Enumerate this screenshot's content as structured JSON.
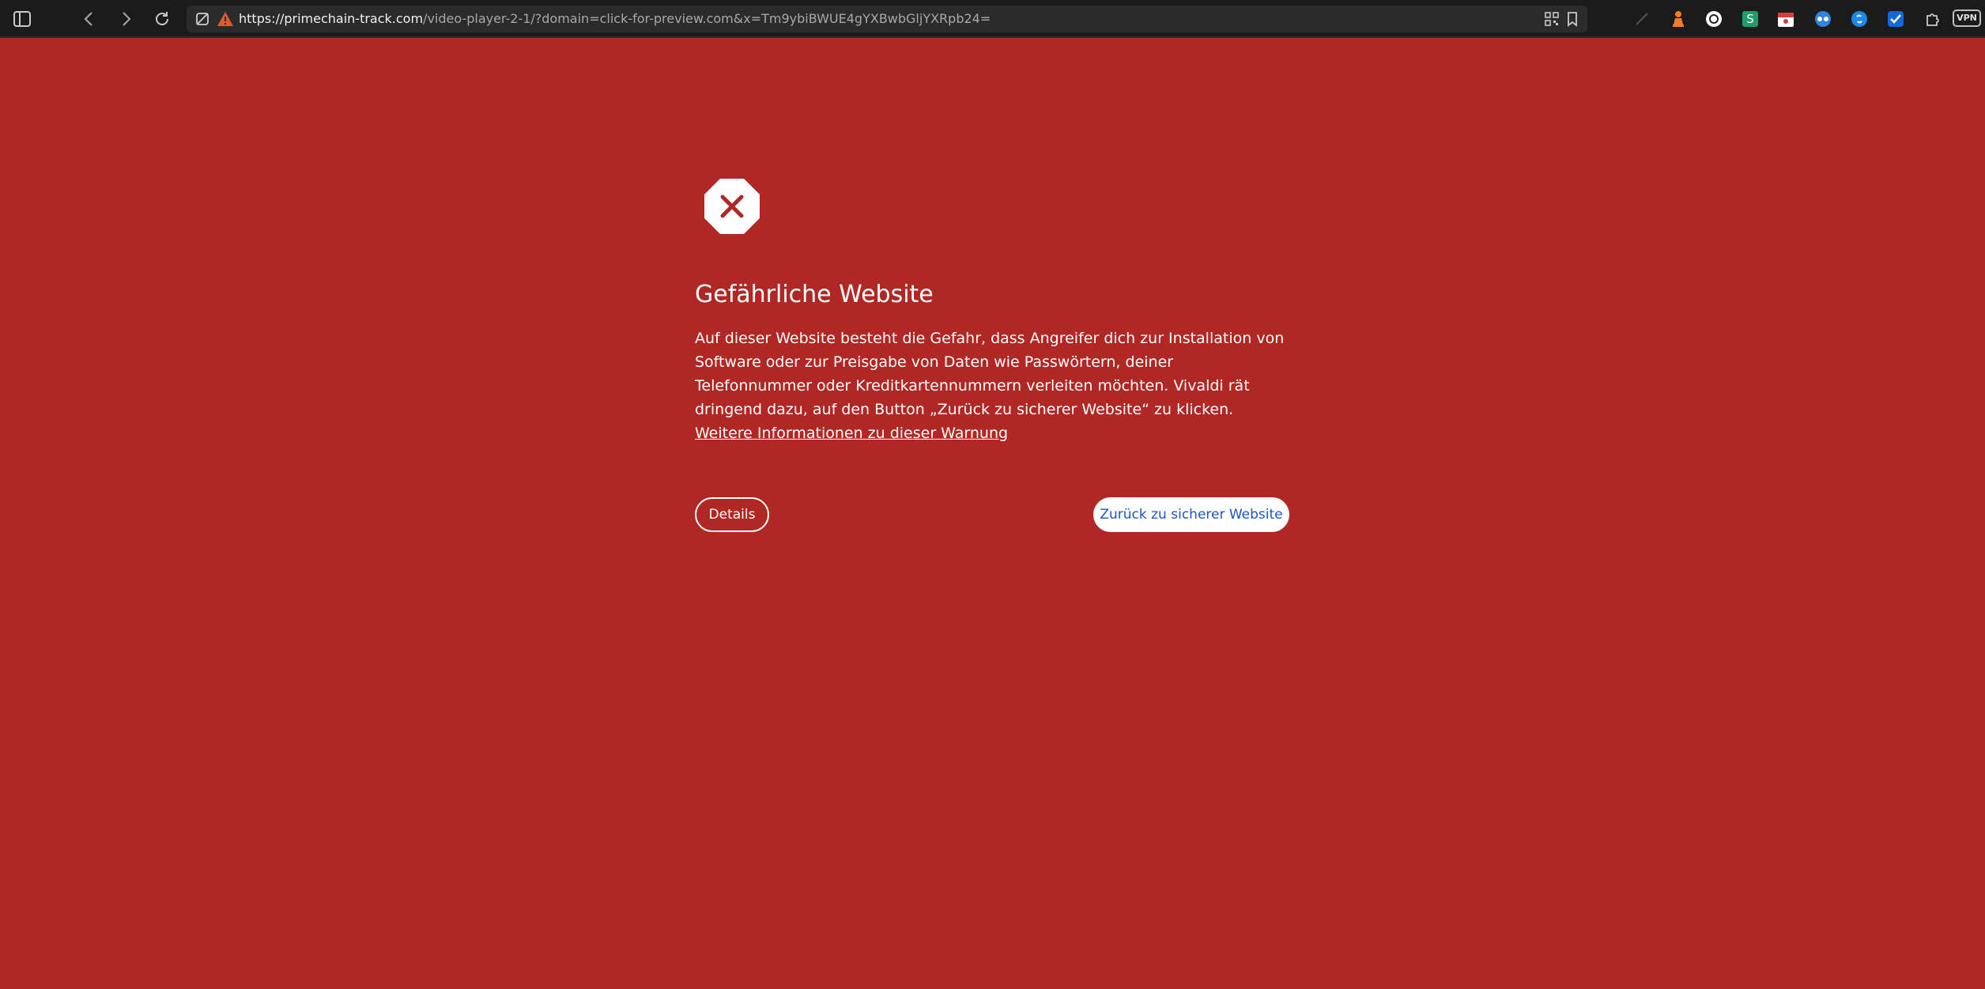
{
  "browser": {
    "url_host": "https://primechain-track.com",
    "url_rest": "/video-player-2-1/?domain=click-for-preview.com&x=Tm9ybiBWUE4gYXBwbGljYXRpb24=",
    "vpn_label": "VPN",
    "toolbar_icons": [
      "panel-toggle-icon",
      "back-icon",
      "forward-icon",
      "reload-icon"
    ],
    "extension_icons": [
      "feather-icon",
      "chess-pawn-icon",
      "circle-extension-icon",
      "s-extension-icon",
      "calendar-icon",
      "glasses-icon",
      "shazam-icon",
      "checkmark-icon",
      "puzzle-icon"
    ]
  },
  "warning": {
    "icon": "stop-x-icon",
    "title": "Gefährliche Website",
    "body": "Auf dieser Website besteht die Gefahr, dass Angreifer dich zur Installation von Software oder zur Preisgabe von Daten wie Passwörtern, deiner Telefonnummer oder Kreditkartennummern verleiten möchten. Vivaldi rät dringend dazu, auf den Button „Zurück zu sicherer Website“ zu klicken. ",
    "more_info_link": "Weitere Informationen zu dieser Warnung",
    "details_button": "Details",
    "back_button": "Zurück zu sicherer Website"
  },
  "colors": {
    "page_background": "#b12724",
    "back_button_text": "#1a55c9",
    "toolbar_background": "#1b1b1b"
  }
}
